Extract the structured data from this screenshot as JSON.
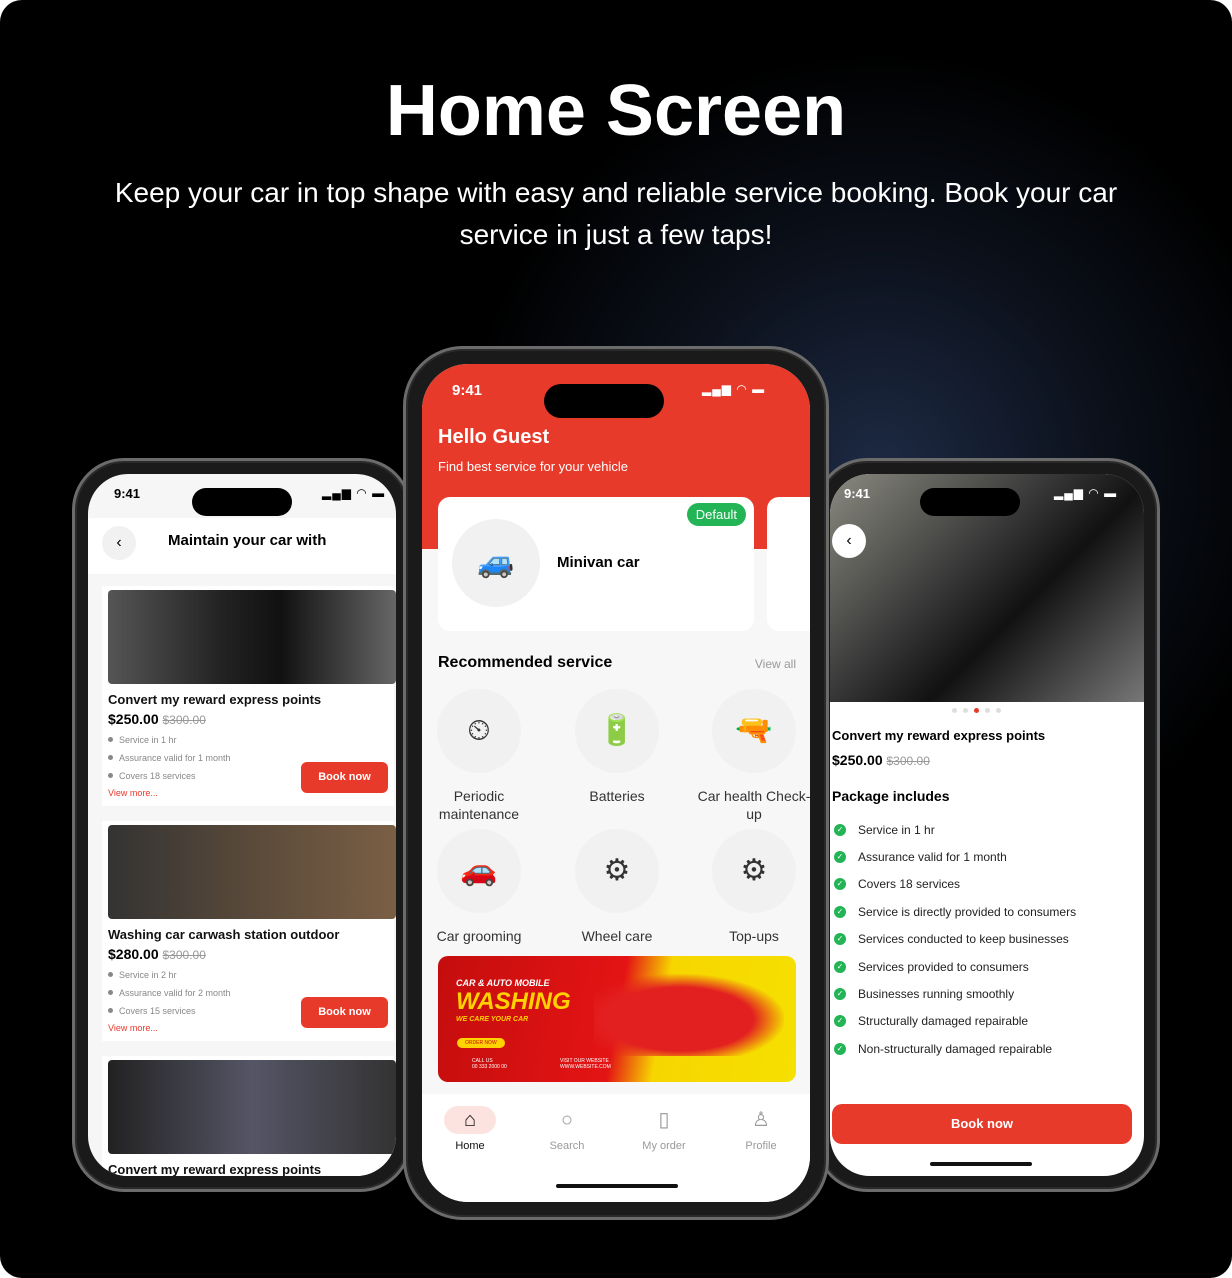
{
  "header": {
    "title": "Home Screen",
    "subtitle": "Keep your car in top shape with easy and reliable service booking. Book your car service in just a few taps!"
  },
  "left": {
    "time": "9:41",
    "title": "Maintain your car with",
    "cards": [
      {
        "title": "Convert my reward express  points",
        "price": "$250.00",
        "old_price": "$300.00",
        "bullets": [
          "Service  in 1 hr",
          "Assurance valid for 1 month",
          "Covers 18 services"
        ],
        "more": "View more...",
        "book": "Book now"
      },
      {
        "title": "Washing car carwash station outdoor",
        "price": "$280.00",
        "old_price": "$300.00",
        "bullets": [
          "Service  in 2 hr",
          "Assurance valid for 2 month",
          "Covers 15 services"
        ],
        "more": "View more...",
        "book": "Book now"
      },
      {
        "title": "Convert my reward express  points"
      }
    ]
  },
  "center": {
    "time": "9:41",
    "greeting": "Hello Guest",
    "tagline": "Find best service for your vehicle",
    "vehicle": {
      "name": "Minivan car",
      "badge": "Default"
    },
    "section_title": "Recommended service",
    "view_all": "View all",
    "services": [
      {
        "label": "Periodic maintenance",
        "icon": "gauge-icon"
      },
      {
        "label": "Batteries",
        "icon": "battery-icon"
      },
      {
        "label": "Car health Check-up",
        "icon": "spray-gun-icon"
      },
      {
        "label": "Car grooming",
        "icon": "car-icon"
      },
      {
        "label": "Wheel care",
        "icon": "wheel-icon"
      },
      {
        "label": "Top-ups",
        "icon": "gears-icon"
      }
    ],
    "banner": {
      "line1": "CAR & AUTO MOBILE",
      "line2": "WASHING",
      "line3": "WE CARE YOUR CAR",
      "cta": "ORDER NOW",
      "call_label": "CALL US",
      "phone": "00 333 2000 00",
      "web_label": "VISIT OUR WEBSITE",
      "web": "WWW.WEBSITE.COM"
    },
    "nav": [
      {
        "label": "Home",
        "icon": "home-icon"
      },
      {
        "label": "Search",
        "icon": "search-icon"
      },
      {
        "label": "My order",
        "icon": "clipboard-icon"
      },
      {
        "label": "Profile",
        "icon": "user-icon"
      }
    ],
    "colors": {
      "accent": "#e83a2b",
      "badge": "#22b455"
    }
  },
  "right": {
    "time": "9:41",
    "title": "Convert my reward express  points",
    "price": "$250.00",
    "old_price": "$300.00",
    "package_title": "Package includes",
    "items": [
      "Service  in 1 hr",
      "Assurance valid for 1 month",
      "Covers 18 services",
      "Service is directly provided to consumers",
      "Services conducted to keep businesses",
      "Services provided to consumers",
      "Businesses running smoothly",
      "Structurally damaged repairable",
      "Non-structurally damaged repairable"
    ],
    "book": "Book now",
    "carousel_active": 3
  }
}
